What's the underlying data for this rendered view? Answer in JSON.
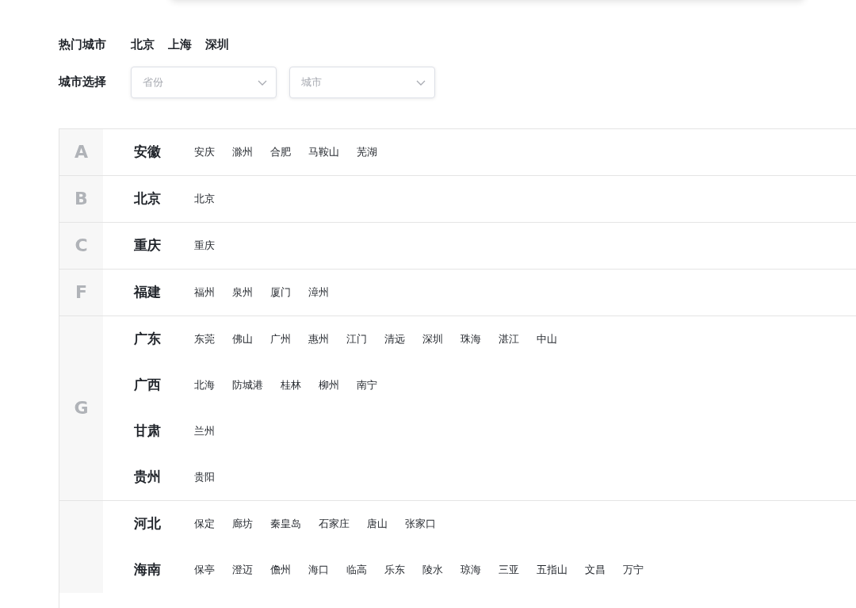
{
  "hot_cities": {
    "label": "热门城市",
    "cities": [
      "北京",
      "上海",
      "深圳"
    ]
  },
  "city_select": {
    "label": "城市选择",
    "province": {
      "placeholder": "省份"
    },
    "city": {
      "placeholder": "城市"
    }
  },
  "groups": [
    {
      "letter": "A",
      "provinces": [
        {
          "name": "安徽",
          "cities": [
            "安庆",
            "滁州",
            "合肥",
            "马鞍山",
            "芜湖"
          ]
        }
      ]
    },
    {
      "letter": "B",
      "provinces": [
        {
          "name": "北京",
          "cities": [
            "北京"
          ]
        }
      ]
    },
    {
      "letter": "C",
      "provinces": [
        {
          "name": "重庆",
          "cities": [
            "重庆"
          ]
        }
      ]
    },
    {
      "letter": "F",
      "provinces": [
        {
          "name": "福建",
          "cities": [
            "福州",
            "泉州",
            "厦门",
            "漳州"
          ]
        }
      ]
    },
    {
      "letter": "G",
      "provinces": [
        {
          "name": "广东",
          "cities": [
            "东莞",
            "佛山",
            "广州",
            "惠州",
            "江门",
            "清远",
            "深圳",
            "珠海",
            "湛江",
            "中山"
          ]
        },
        {
          "name": "广西",
          "cities": [
            "北海",
            "防城港",
            "桂林",
            "柳州",
            "南宁"
          ]
        },
        {
          "name": "甘肃",
          "cities": [
            "兰州"
          ]
        },
        {
          "name": "贵州",
          "cities": [
            "贵阳"
          ]
        }
      ]
    },
    {
      "provinces": [
        {
          "name": "河北",
          "cities": [
            "保定",
            "廊坊",
            "秦皇岛",
            "石家庄",
            "唐山",
            "张家口"
          ]
        },
        {
          "name": "海南",
          "cities": [
            "保亭",
            "澄迈",
            "儋州",
            "海口",
            "临高",
            "乐东",
            "陵水",
            "琼海",
            "三亚",
            "五指山",
            "文昌",
            "万宁"
          ]
        }
      ]
    }
  ]
}
